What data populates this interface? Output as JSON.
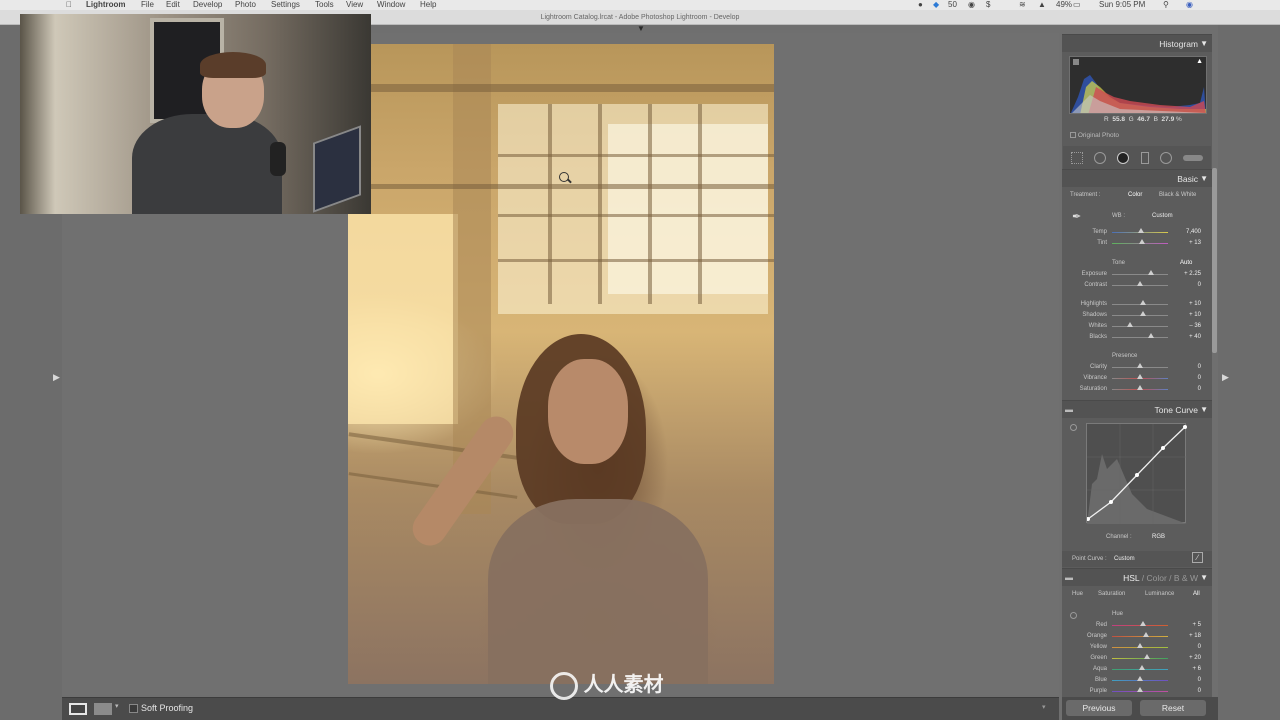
{
  "menubar": {
    "app": "Lightroom",
    "items": [
      "File",
      "Edit",
      "Develop",
      "Photo",
      "Settings",
      "Tools",
      "View",
      "Window",
      "Help"
    ],
    "battery": "49%",
    "clock": "Sun 9:05 PM",
    "badge": "50"
  },
  "window": {
    "title": "Lightroom Catalog.lrcat - Adobe Photoshop Lightroom - Develop"
  },
  "histogram": {
    "title": "Histogram",
    "r_label": "R",
    "r_value": "55.8",
    "g_label": "G",
    "g_value": "46.7",
    "b_label": "B",
    "b_value": "27.9",
    "pct": "%",
    "original_label": "Original Photo"
  },
  "basic": {
    "title": "Basic",
    "treatment_label": "Treatment :",
    "treatment_color": "Color",
    "treatment_bw": "Black & White",
    "wb_label": "WB :",
    "wb_value": "Custom",
    "temp_label": "Temp",
    "temp_value": "7,400",
    "temp_pos": 0.52,
    "tint_label": "Tint",
    "tint_value": "+ 13",
    "tint_pos": 0.53,
    "tone_label": "Tone",
    "auto_label": "Auto",
    "exposure_label": "Exposure",
    "exposure_value": "+ 2.25",
    "exposure_pos": 0.7,
    "contrast_label": "Contrast",
    "contrast_value": "0",
    "contrast_pos": 0.5,
    "highlights_label": "Highlights",
    "highlights_value": "+ 10",
    "highlights_pos": 0.55,
    "shadows_label": "Shadows",
    "shadows_value": "+ 10",
    "shadows_pos": 0.55,
    "whites_label": "Whites",
    "whites_value": "– 36",
    "whites_pos": 0.32,
    "blacks_label": "Blacks",
    "blacks_value": "+ 40",
    "blacks_pos": 0.7,
    "presence_label": "Presence",
    "clarity_label": "Clarity",
    "clarity_value": "0",
    "clarity_pos": 0.5,
    "vibrance_label": "Vibrance",
    "vibrance_value": "0",
    "vibrance_pos": 0.5,
    "saturation_label": "Saturation",
    "saturation_value": "0",
    "saturation_pos": 0.5
  },
  "tone_curve": {
    "title": "Tone Curve",
    "channel_label": "Channel :",
    "channel_value": "RGB",
    "point_curve_label": "Point Curve :",
    "point_curve_value": "Custom"
  },
  "hsl": {
    "title_hsl": "HSL",
    "sep": "/",
    "title_color": "Color",
    "title_bw": "B & W",
    "tabs": [
      "Hue",
      "Saturation",
      "Luminance",
      "All"
    ],
    "section": "Hue",
    "red_label": "Red",
    "red_value": "+ 5",
    "red_pos": 0.55,
    "orange_label": "Orange",
    "orange_value": "+ 18",
    "orange_pos": 0.6,
    "yellow_label": "Yellow",
    "yellow_value": "0",
    "yellow_pos": 0.5,
    "green_label": "Green",
    "green_value": "+ 20",
    "green_pos": 0.62,
    "aqua_label": "Aqua",
    "aqua_value": "+ 6",
    "aqua_pos": 0.54,
    "blue_label": "Blue",
    "blue_value": "0",
    "blue_pos": 0.5,
    "purple_label": "Purple",
    "purple_value": "0",
    "purple_pos": 0.5
  },
  "bottom": {
    "soft_proofing": "Soft Proofing",
    "previous": "Previous",
    "reset": "Reset"
  },
  "watermark": "人人素材"
}
